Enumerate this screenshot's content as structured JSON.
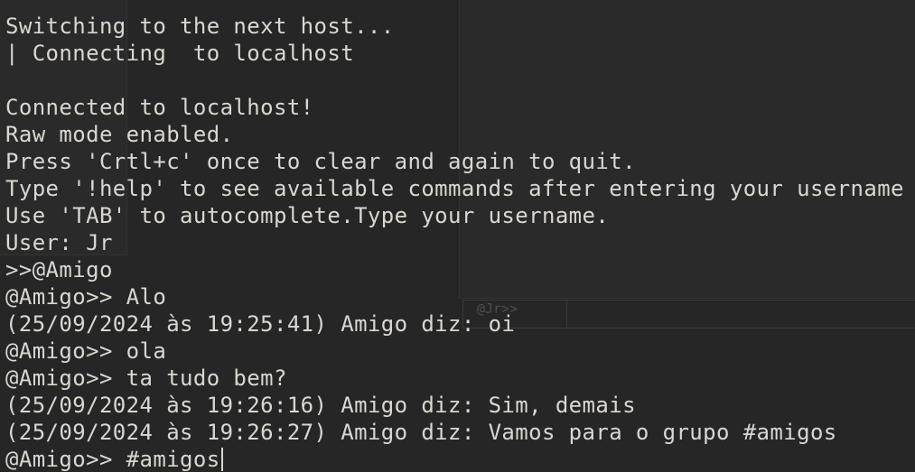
{
  "terminal": {
    "ghost_prompt": "@Jr>>",
    "lines": [
      "Switching to the next host...",
      "| Connecting  to localhost",
      "",
      "Connected to localhost!",
      "Raw mode enabled.",
      "Press 'Crtl+c' once to clear and again to quit.",
      "Type '!help' to see available commands after entering your username",
      "Use 'TAB' to autocomplete.Type your username.",
      "User: Jr",
      ">>@Amigo",
      "@Amigo>> Alo",
      "(25/09/2024 às 19:25:41) Amigo diz: oi",
      "@Amigo>> ola",
      "@Amigo>> ta tudo bem?",
      "(25/09/2024 às 19:26:16) Amigo diz: Sim, demais",
      "(25/09/2024 às 19:26:27) Amigo diz: Vamos para o grupo #amigos"
    ],
    "input_line": "@Amigo>> #amigos"
  },
  "colors": {
    "background": "#262626",
    "text": "#dad7d0",
    "ghost": "#4e4e4e"
  }
}
